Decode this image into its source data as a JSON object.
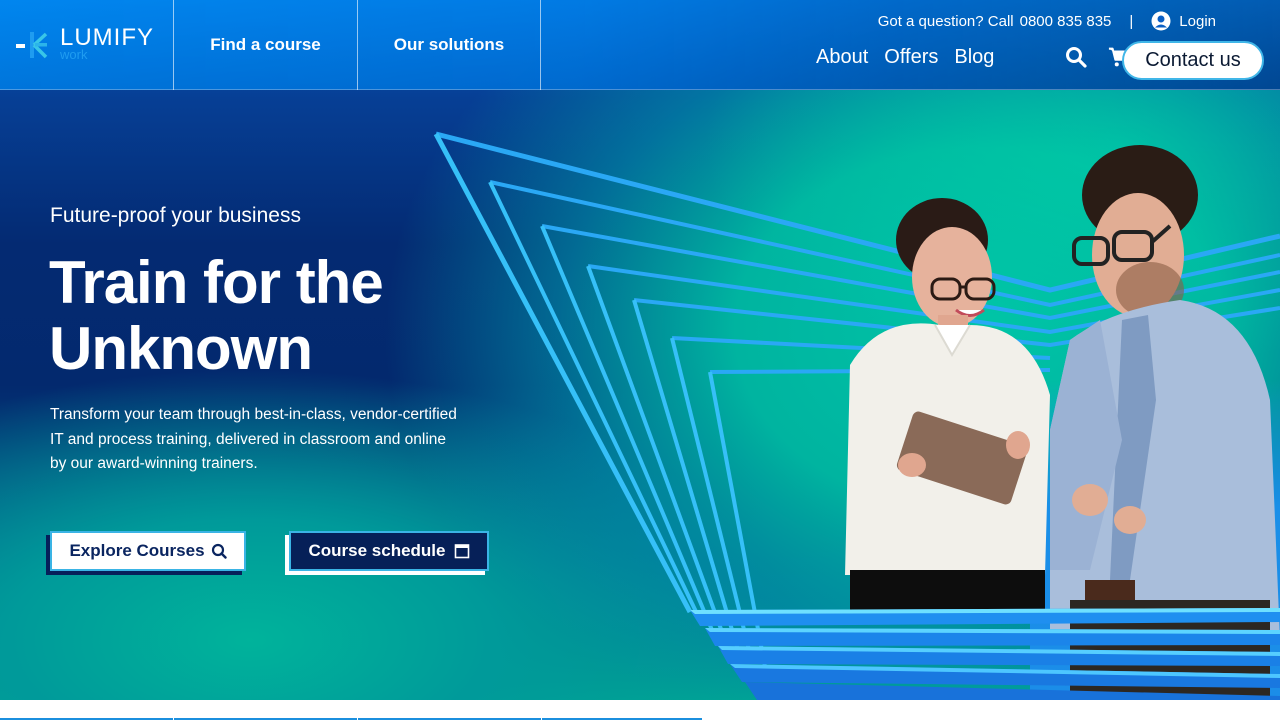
{
  "brand": {
    "name": "LUMIFY",
    "sub": "work",
    "accent": "#1f9cf0",
    "navy": "#062058",
    "teal": "#00c3a6"
  },
  "header": {
    "nav_cells": [
      {
        "label": "Find a course"
      },
      {
        "label": "Our solutions"
      }
    ],
    "topbar": {
      "question": "Got a question? Call",
      "phone": "0800 835 835",
      "separator": "|",
      "login": "Login"
    },
    "main_nav": [
      {
        "label": "About"
      },
      {
        "label": "Offers"
      },
      {
        "label": "Blog"
      }
    ],
    "icons": {
      "search": "search-icon",
      "cart": "cart-icon",
      "user": "user-circle-icon"
    },
    "contact_label": "Contact us"
  },
  "hero": {
    "eyebrow": "Future-proof your business",
    "headline_line1": "Train for the",
    "headline_line2": "Unknown",
    "lead": "Transform your team through best-in-class, vendor-certified IT and process training, delivered in classroom and online by our award-winning trainers.",
    "buttons": {
      "explore": "Explore Courses",
      "schedule": "Course schedule"
    },
    "image_alt": "Two professionals looking at a tablet in front of neon blue lines"
  }
}
